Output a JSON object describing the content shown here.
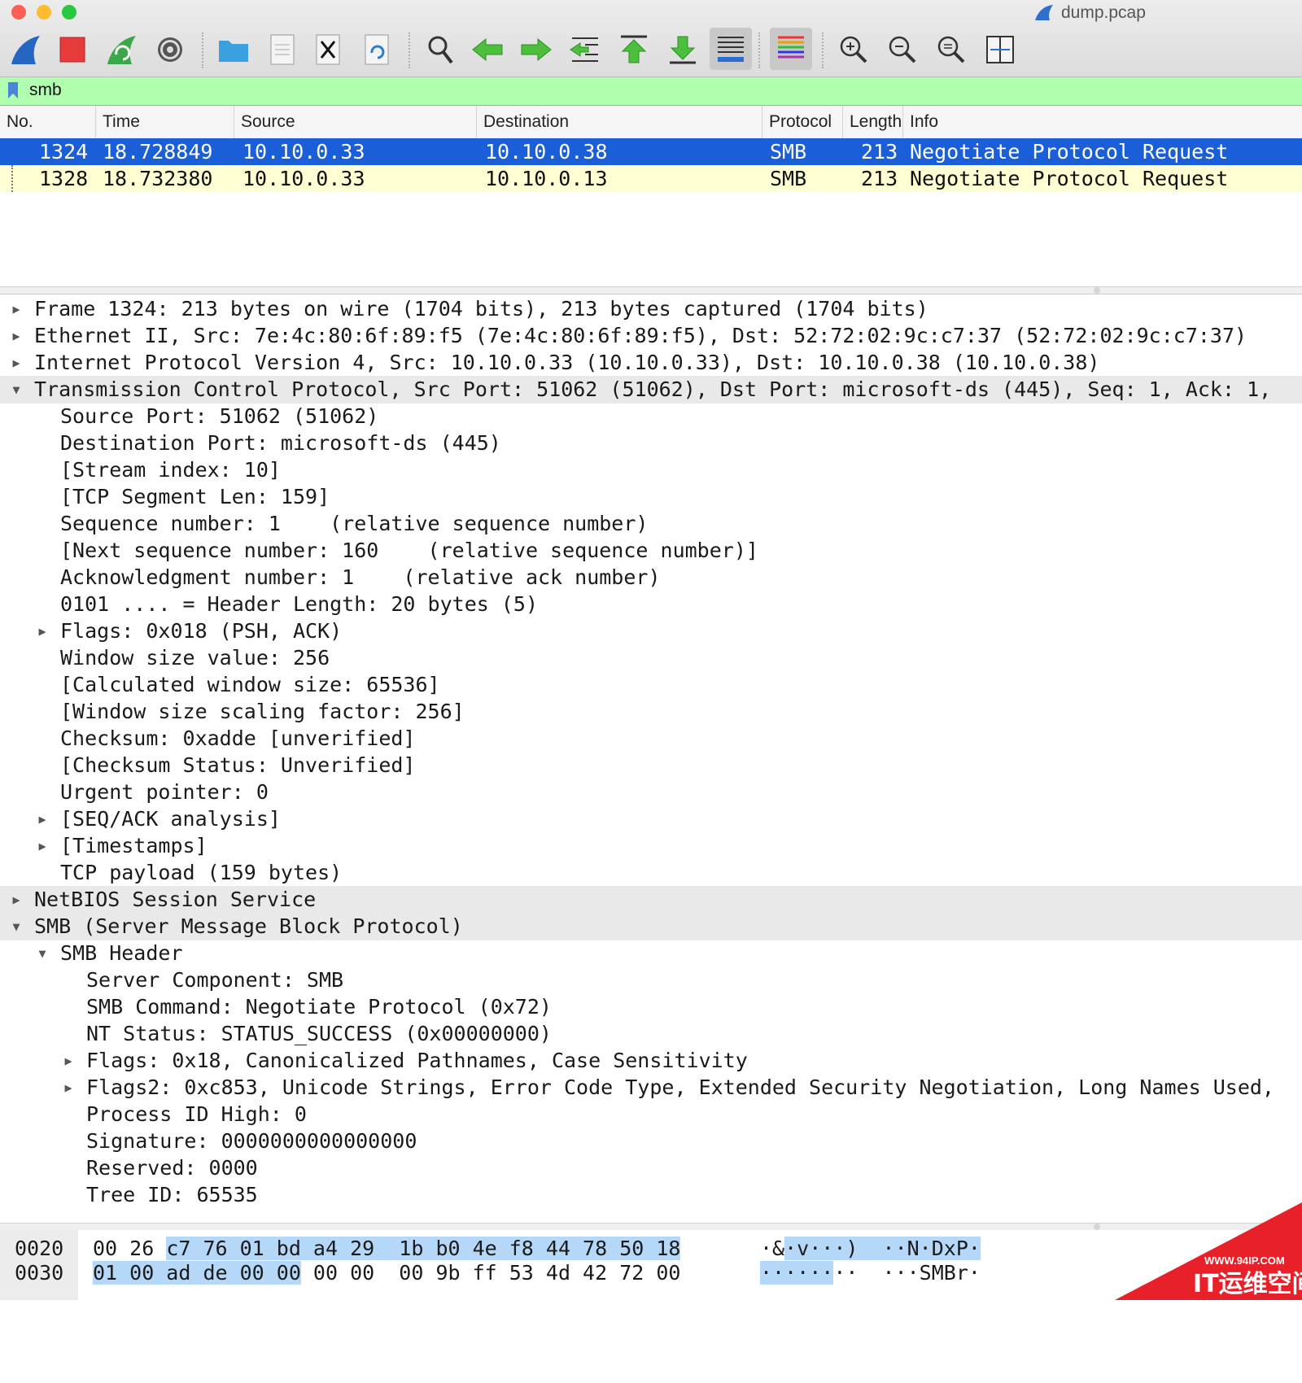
{
  "window": {
    "title": "dump.pcap"
  },
  "toolbar": {
    "buttons": [
      {
        "icon": "shark-fin-start-icon"
      },
      {
        "icon": "stop-capture-icon"
      },
      {
        "icon": "restart-capture-icon"
      },
      {
        "icon": "capture-options-gear-icon"
      },
      {
        "icon": "open-folder-icon"
      },
      {
        "icon": "save-file-icon"
      },
      {
        "icon": "close-file-icon"
      },
      {
        "icon": "reload-file-icon"
      },
      {
        "icon": "find-packet-icon"
      },
      {
        "icon": "go-back-icon"
      },
      {
        "icon": "go-forward-icon"
      },
      {
        "icon": "go-to-packet-icon"
      },
      {
        "icon": "go-first-packet-icon"
      },
      {
        "icon": "go-last-packet-icon"
      },
      {
        "icon": "auto-scroll-icon"
      },
      {
        "icon": "colorize-icon"
      },
      {
        "icon": "zoom-in-icon"
      },
      {
        "icon": "zoom-out-icon"
      },
      {
        "icon": "normal-size-icon"
      },
      {
        "icon": "resize-columns-icon"
      }
    ]
  },
  "filter": {
    "value": "smb"
  },
  "packet_list": {
    "columns": [
      "No.",
      "Time",
      "Source",
      "Destination",
      "Protocol",
      "Length",
      "Info"
    ],
    "rows": [
      {
        "no": "1324",
        "time": "18.728849",
        "source": "10.10.0.33",
        "destination": "10.10.0.38",
        "protocol": "SMB",
        "length": "213",
        "info": "Negotiate Protocol Request",
        "selected": true
      },
      {
        "no": "1328",
        "time": "18.732380",
        "source": "10.10.0.33",
        "destination": "10.10.0.13",
        "protocol": "SMB",
        "length": "213",
        "info": "Negotiate Protocol Request",
        "selected": false
      }
    ]
  },
  "details": [
    {
      "text": "Frame 1324: 213 bytes on wire (1704 bits), 213 bytes captured (1704 bits)",
      "indent": 0,
      "arrow": "collapsed"
    },
    {
      "text": "Ethernet II, Src: 7e:4c:80:6f:89:f5 (7e:4c:80:6f:89:f5), Dst: 52:72:02:9c:c7:37 (52:72:02:9c:c7:37)",
      "indent": 0,
      "arrow": "collapsed"
    },
    {
      "text": "Internet Protocol Version 4, Src: 10.10.0.33 (10.10.0.33), Dst: 10.10.0.38 (10.10.0.38)",
      "indent": 0,
      "arrow": "collapsed"
    },
    {
      "text": "Transmission Control Protocol, Src Port: 51062 (51062), Dst Port: microsoft-ds (445), Seq: 1, Ack: 1,",
      "indent": 0,
      "arrow": "expanded",
      "highlight": true
    },
    {
      "text": "Source Port: 51062 (51062)",
      "indent": 1,
      "arrow": "none"
    },
    {
      "text": "Destination Port: microsoft-ds (445)",
      "indent": 1,
      "arrow": "none"
    },
    {
      "text": "[Stream index: 10]",
      "indent": 1,
      "arrow": "none"
    },
    {
      "text": "[TCP Segment Len: 159]",
      "indent": 1,
      "arrow": "none"
    },
    {
      "text": "Sequence number: 1    (relative sequence number)",
      "indent": 1,
      "arrow": "none"
    },
    {
      "text": "[Next sequence number: 160    (relative sequence number)]",
      "indent": 1,
      "arrow": "none"
    },
    {
      "text": "Acknowledgment number: 1    (relative ack number)",
      "indent": 1,
      "arrow": "none"
    },
    {
      "text": "0101 .... = Header Length: 20 bytes (5)",
      "indent": 1,
      "arrow": "none"
    },
    {
      "text": "Flags: 0x018 (PSH, ACK)",
      "indent": 1,
      "arrow": "collapsed"
    },
    {
      "text": "Window size value: 256",
      "indent": 1,
      "arrow": "none"
    },
    {
      "text": "[Calculated window size: 65536]",
      "indent": 1,
      "arrow": "none"
    },
    {
      "text": "[Window size scaling factor: 256]",
      "indent": 1,
      "arrow": "none"
    },
    {
      "text": "Checksum: 0xadde [unverified]",
      "indent": 1,
      "arrow": "none"
    },
    {
      "text": "[Checksum Status: Unverified]",
      "indent": 1,
      "arrow": "none"
    },
    {
      "text": "Urgent pointer: 0",
      "indent": 1,
      "arrow": "none"
    },
    {
      "text": "[SEQ/ACK analysis]",
      "indent": 1,
      "arrow": "collapsed"
    },
    {
      "text": "[Timestamps]",
      "indent": 1,
      "arrow": "collapsed"
    },
    {
      "text": "TCP payload (159 bytes)",
      "indent": 1,
      "arrow": "none"
    },
    {
      "text": "NetBIOS Session Service",
      "indent": 0,
      "arrow": "collapsed",
      "highlight": true
    },
    {
      "text": "SMB (Server Message Block Protocol)",
      "indent": 0,
      "arrow": "expanded",
      "highlight": true
    },
    {
      "text": "SMB Header",
      "indent": 1,
      "arrow": "expanded"
    },
    {
      "text": "Server Component: SMB",
      "indent": 2,
      "arrow": "none"
    },
    {
      "text": "SMB Command: Negotiate Protocol (0x72)",
      "indent": 2,
      "arrow": "none"
    },
    {
      "text": "NT Status: STATUS_SUCCESS (0x00000000)",
      "indent": 2,
      "arrow": "none"
    },
    {
      "text": "Flags: 0x18, Canonicalized Pathnames, Case Sensitivity",
      "indent": 2,
      "arrow": "collapsed"
    },
    {
      "text": "Flags2: 0xc853, Unicode Strings, Error Code Type, Extended Security Negotiation, Long Names Used,",
      "indent": 2,
      "arrow": "collapsed"
    },
    {
      "text": "Process ID High: 0",
      "indent": 2,
      "arrow": "none"
    },
    {
      "text": "Signature: 0000000000000000",
      "indent": 2,
      "arrow": "none"
    },
    {
      "text": "Reserved: 0000",
      "indent": 2,
      "arrow": "none"
    },
    {
      "text": "Tree ID: 65535",
      "indent": 2,
      "arrow": "none"
    }
  ],
  "bytes": [
    {
      "offset": "0020",
      "hex_plain": "00 26 ",
      "hex_sel": "c7 76 01 bd a4 29  1b b0 4e f8 44 78 50 18",
      "hex_rest": "",
      "ascii_plain": "·&",
      "ascii_sel": "·v···)  ··N·DxP·",
      "ascii_rest": ""
    },
    {
      "offset": "0030",
      "hex_plain": "",
      "hex_sel": "01 00 ad de 00 00",
      "hex_rest": " 00 00  00 9b ff 53 4d 42 72 00",
      "ascii_plain": "",
      "ascii_sel": "······",
      "ascii_rest": "··  ···SMBr·"
    }
  ],
  "watermark": {
    "url": "WWW.94IP.COM",
    "name": "IT运维空间"
  },
  "colors": {
    "selected_row": "#1a5fd8",
    "filter_ok": "#afffaf",
    "row_smb": "#ffffd4",
    "byte_selection": "#b5d8f9"
  }
}
